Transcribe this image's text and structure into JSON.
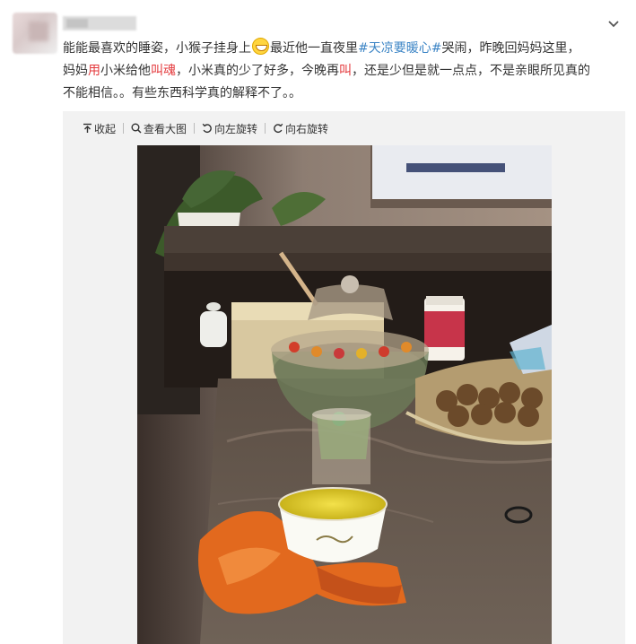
{
  "post": {
    "line1_a": "能能最喜欢的睡姿，小猴子挂身上",
    "line1_b": "最近他一直夜里",
    "topic": "#天凉要暖心#",
    "line1_c": "哭闹，昨晚回妈妈这里，",
    "line2_a": "妈妈",
    "line2_red1": "用",
    "line2_b": "小米给他",
    "line2_red2": "叫魂",
    "line2_c": "，小米真的少了好多，今晚再",
    "line2_red3": "叫",
    "line2_d": "，还是少但是就一点点，不是亲眼所见真的",
    "line3": "不能相信。。有些东西科学真的解释不了。。"
  },
  "toolbar": {
    "collapse": "收起",
    "view_large": "查看大图",
    "rotate_left": "向左旋转",
    "rotate_right": "向右旋转"
  },
  "colors": {
    "topic": "#3b84c5",
    "highlight": "#e4393c",
    "text": "#333333"
  }
}
